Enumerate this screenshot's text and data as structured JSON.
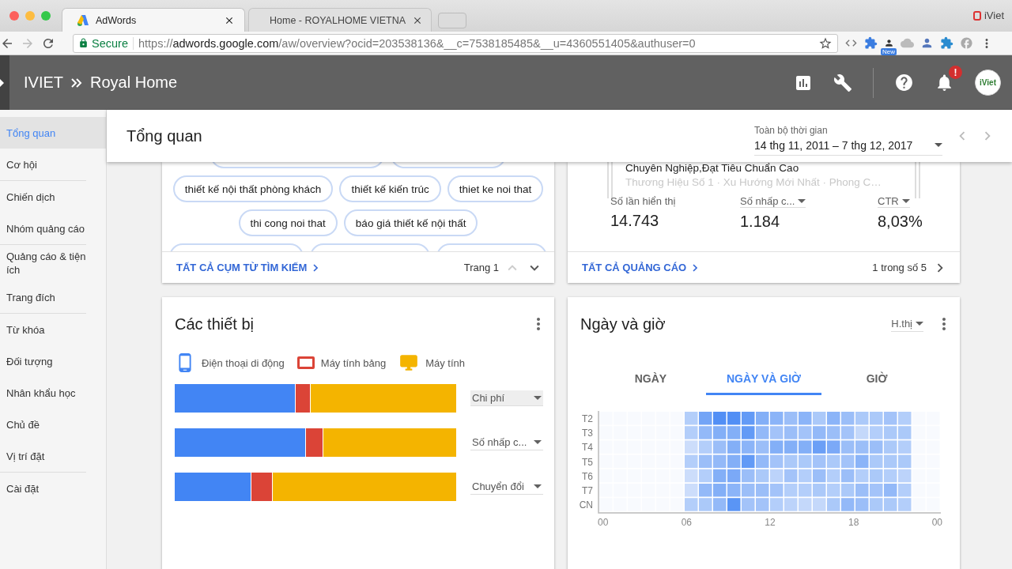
{
  "browser": {
    "tabs": [
      {
        "title": "AdWords",
        "selected": true,
        "kind": "adwords"
      },
      {
        "title": "Home - ROYALHOME VIETNA",
        "selected": false,
        "kind": "loading"
      }
    ],
    "profile": "iViet",
    "secure_label": "Secure",
    "url": {
      "scheme": "https://",
      "host": "adwords.google.com",
      "path": "/aw/overview?ocid=203538136&__c=7538185485&__u=4360551405&authuser=0"
    },
    "extension_badge": "New"
  },
  "header": {
    "breadcrumb": [
      "IVIET",
      "Royal Home"
    ],
    "notification_badge": "!",
    "avatar_text": "iViet"
  },
  "sidebar": {
    "groups": [
      [
        {
          "label": "Tổng quan",
          "selected": true
        },
        {
          "label": "Cơ hội",
          "selected": false
        }
      ],
      [
        {
          "label": "Chiến dịch",
          "selected": false
        },
        {
          "label": "Nhóm quảng cáo",
          "selected": false
        }
      ],
      [
        {
          "label": "Quảng cáo & tiện ích",
          "selected": false
        },
        {
          "label": "Trang đích",
          "selected": false
        }
      ],
      [
        {
          "label": "Từ khóa",
          "selected": false
        },
        {
          "label": "Đối tượng",
          "selected": false
        },
        {
          "label": "Nhân khẩu học",
          "selected": false
        },
        {
          "label": "Chủ đề",
          "selected": false
        },
        {
          "label": "Vị trí đặt",
          "selected": false
        }
      ],
      [
        {
          "label": "Cài đặt",
          "selected": false
        }
      ]
    ]
  },
  "page": {
    "title": "Tổng quan",
    "date_label": "Toàn bộ thời gian",
    "date_range": "14 thg 11, 2011 – 7 thg 12, 2017"
  },
  "search_terms_card": {
    "chip_rows": [
      [
        "thiết kế nội thất phòng khách",
        "thiết kế kiến trúc",
        "thiet ke noi that"
      ],
      [
        "thi cong noi that",
        "báo giá thiết kế nội thất"
      ]
    ],
    "link": "TẤT CẢ CỤM TỪ TÌM KIẾM",
    "page": "Trang 1"
  },
  "ads_card": {
    "headline": "Chuyên Nghiệp,Đạt Tiêu Chuẩn Cao",
    "description": "Thương Hiệu Số 1 · Xu Hướng Mới Nhất · Phong C…",
    "metrics": [
      {
        "label": "Số lần hiển thị",
        "value": "14.743",
        "kind": "static"
      },
      {
        "label": "Số nhấp c...",
        "value": "1.184",
        "kind": "dropdown"
      },
      {
        "label": "CTR",
        "value": "8,03%",
        "kind": "dropdown"
      }
    ],
    "link": "TẤT CẢ QUẢNG CÁO",
    "pager": "1 trong số 5"
  },
  "devices_card": {
    "title": "Các thiết bị",
    "legend": [
      {
        "label": "Điện thoại di động",
        "kind": "phone",
        "color": "#4285f4"
      },
      {
        "label": "Máy tính bảng",
        "kind": "tablet",
        "color": "#db4437"
      },
      {
        "label": "Máy tính",
        "kind": "desktop",
        "color": "#f4b400"
      }
    ],
    "metrics": [
      {
        "label": "Chi phí",
        "hovered": true
      },
      {
        "label": "Số nhấp c...",
        "hovered": false
      },
      {
        "label": "Chuyển đổi",
        "hovered": false
      }
    ]
  },
  "time_card": {
    "title": "Ngày và giờ",
    "metric": "H.thị",
    "tabs": [
      {
        "label": "NGÀY",
        "selected": false
      },
      {
        "label": "NGÀY VÀ GIỜ",
        "selected": true
      },
      {
        "label": "GIỜ",
        "selected": false
      }
    ],
    "rows": [
      "T2",
      "T3",
      "T4",
      "T5",
      "T6",
      "T7",
      "CN"
    ],
    "x_labels": [
      "00",
      "06",
      "12",
      "18",
      "00"
    ]
  }
}
